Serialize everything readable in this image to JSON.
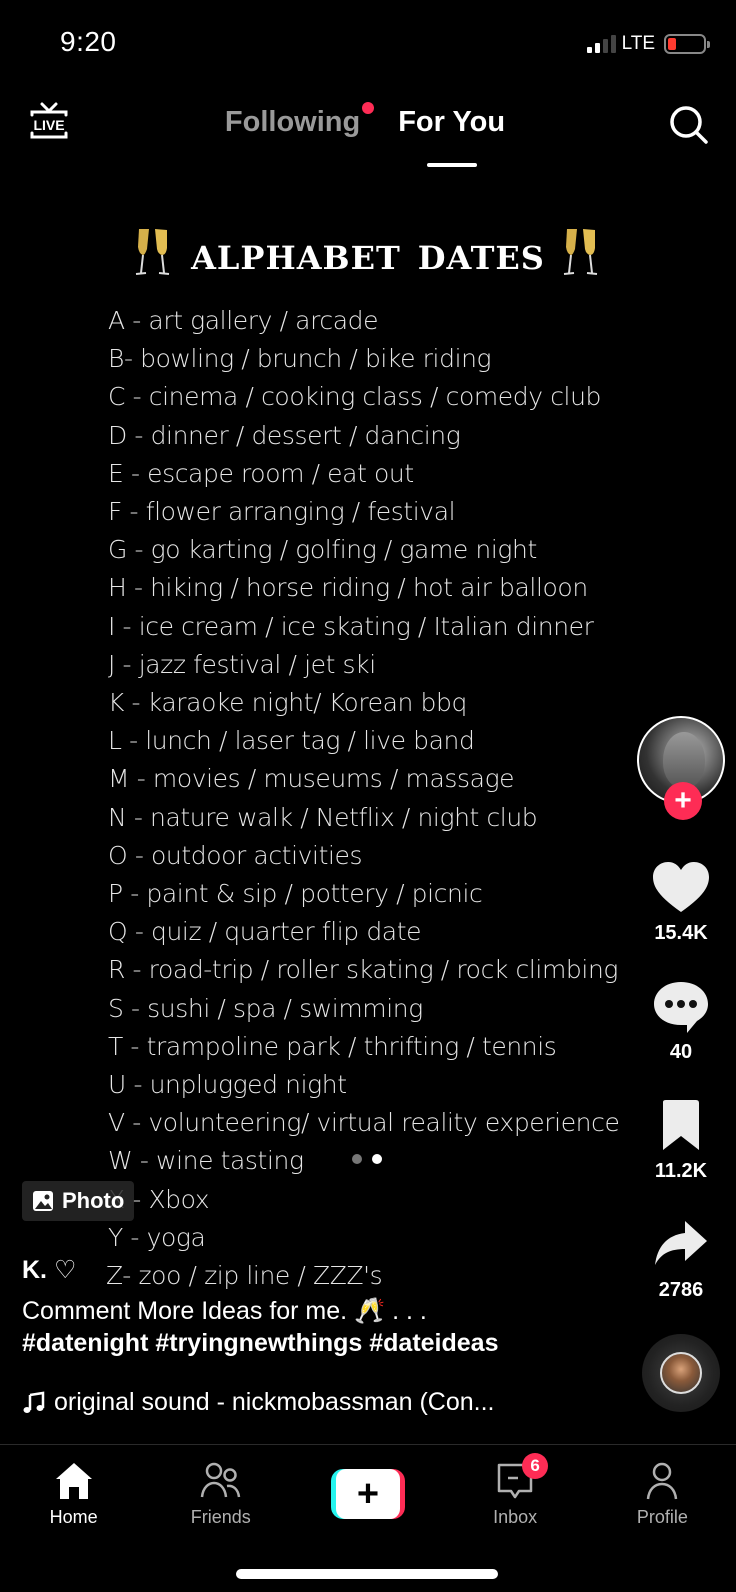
{
  "status_bar": {
    "time": "9:20",
    "network": "LTE",
    "signal_bars_active": 2,
    "signal_bars_total": 4,
    "battery_level": "low"
  },
  "top_nav": {
    "live_label": "LIVE",
    "tabs": [
      {
        "label": "Following",
        "active": false,
        "has_notification_dot": true
      },
      {
        "label": "For You",
        "active": true
      }
    ]
  },
  "post": {
    "title": "alphabet dates",
    "title_emoji": "🥂",
    "items": [
      "A - art gallery / arcade",
      "B- bowling / brunch / bike riding",
      "C - cinema / cooking class / comedy club",
      "D - dinner / dessert / dancing",
      "E - escape room / eat out",
      "F - flower arranging / festival",
      "G - go karting / golfing / game night",
      "H - hiking / horse riding / hot air balloon",
      "I - ice cream / ice skating / Italian dinner",
      "J - jazz festival / jet ski",
      "K - karaoke night/ Korean bbq",
      "L - lunch / laser tag / live band",
      "M - movies / museums / massage",
      "N - nature walk / Netflix / night club",
      "O - outdoor activities",
      "P - paint & sip / pottery / picnic",
      "Q - quiz / quarter flip date",
      "R - road-trip / roller skating / rock climbing",
      "S - sushi / spa / swimming",
      "T - trampoline park / thrifting / tennis",
      "U - unplugged night",
      "V -  volunteering/ virtual reality experience",
      "W - wine tasting",
      "X - Xbox",
      "Y - yoga",
      "Z- zoo / zip line / ZZZ's"
    ],
    "pager": {
      "current": 2,
      "total": 2
    },
    "type_badge": "Photo",
    "author": "K. ♡",
    "caption": "Comment More Ideas for me. 🥂 . . .",
    "hashtags": "#datenight #tryingnewthings #dateideas",
    "sound": "original sound - nickmobassman (Con..."
  },
  "actions": {
    "likes": "15.4K",
    "comments": "40",
    "saves": "11.2K",
    "shares": "2786"
  },
  "bottom_nav": {
    "items": [
      {
        "label": "Home",
        "active": true
      },
      {
        "label": "Friends",
        "active": false
      },
      {
        "label": "",
        "type": "create"
      },
      {
        "label": "Inbox",
        "active": false,
        "badge": "6"
      },
      {
        "label": "Profile",
        "active": false
      }
    ]
  },
  "colors": {
    "accent": "#fe2c55",
    "cyan": "#25f4ee",
    "background": "#000000"
  }
}
